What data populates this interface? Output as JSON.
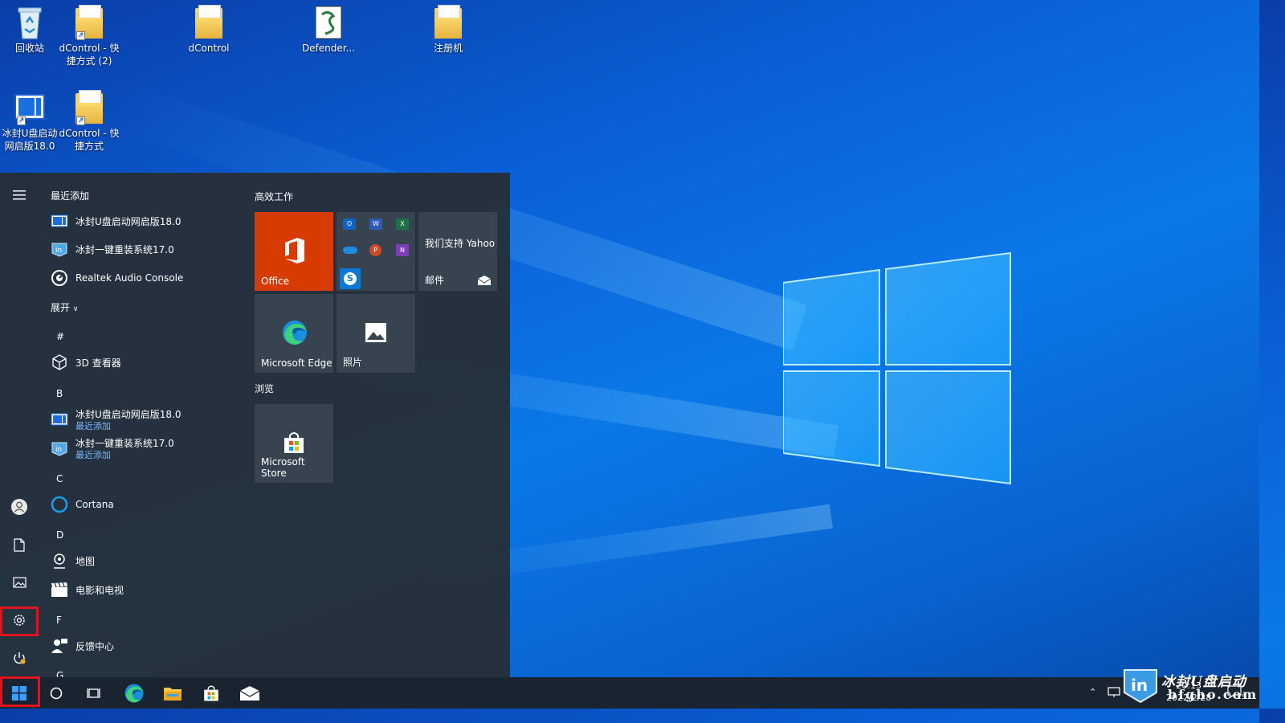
{
  "desktop": {
    "icons": [
      {
        "label": "回收站",
        "icon": "recycle-bin-icon"
      },
      {
        "label": "dControl - 快捷方式 (2)",
        "icon": "folder-shortcut-icon"
      },
      {
        "label": "dControl",
        "icon": "folder-icon"
      },
      {
        "label": "Defender...",
        "icon": "script-file-icon"
      },
      {
        "label": "注册机",
        "icon": "folder-icon"
      },
      {
        "label": "冰封U盘启动网启版18.0",
        "icon": "app-shortcut-icon"
      },
      {
        "label": "dControl - 快捷方式",
        "icon": "folder-shortcut-icon"
      }
    ]
  },
  "start_menu": {
    "recent_header": "最近添加",
    "recent": [
      {
        "label": "冰封U盘启动网启版18.0",
        "icon": "bingfeng-usb-icon"
      },
      {
        "label": "冰封一键重装系统17.0",
        "icon": "bingfeng-reinstall-icon"
      },
      {
        "label": "Realtek Audio Console",
        "icon": "realtek-audio-icon"
      }
    ],
    "expand": "展开",
    "sections": [
      {
        "letter": "#"
      },
      {
        "letter": "B"
      },
      {
        "letter": "C"
      },
      {
        "letter": "D"
      },
      {
        "letter": "F"
      },
      {
        "letter": "G"
      }
    ],
    "apps": [
      {
        "label": "3D 查看器",
        "sub": ""
      },
      {
        "label": "冰封U盘启动网启版18.0",
        "sub": "最近添加"
      },
      {
        "label": "冰封一键重装系统17.0",
        "sub": "最近添加"
      },
      {
        "label": "Cortana",
        "sub": ""
      },
      {
        "label": "地图",
        "sub": ""
      },
      {
        "label": "电影和电视",
        "sub": ""
      },
      {
        "label": "反馈中心",
        "sub": ""
      }
    ],
    "tile_groups": {
      "productivity": "高效工作",
      "browse": "浏览"
    },
    "tiles": {
      "office": "Office",
      "yahoo": "我们支持 Yahoo",
      "mail": "邮件",
      "edge": "Microsoft Edge",
      "photos": "照片",
      "store": "Microsoft Store"
    }
  },
  "taskbar": {
    "clock_time": "20:13",
    "clock_date": "2022/2/28",
    "notification_count": "15"
  },
  "watermark": {
    "text": "冰封U盘启动",
    "url": "bfgho.com"
  },
  "colors": {
    "office_tile": "#d83b01",
    "highlight": "#e0141e",
    "accent": "#0078d7"
  }
}
